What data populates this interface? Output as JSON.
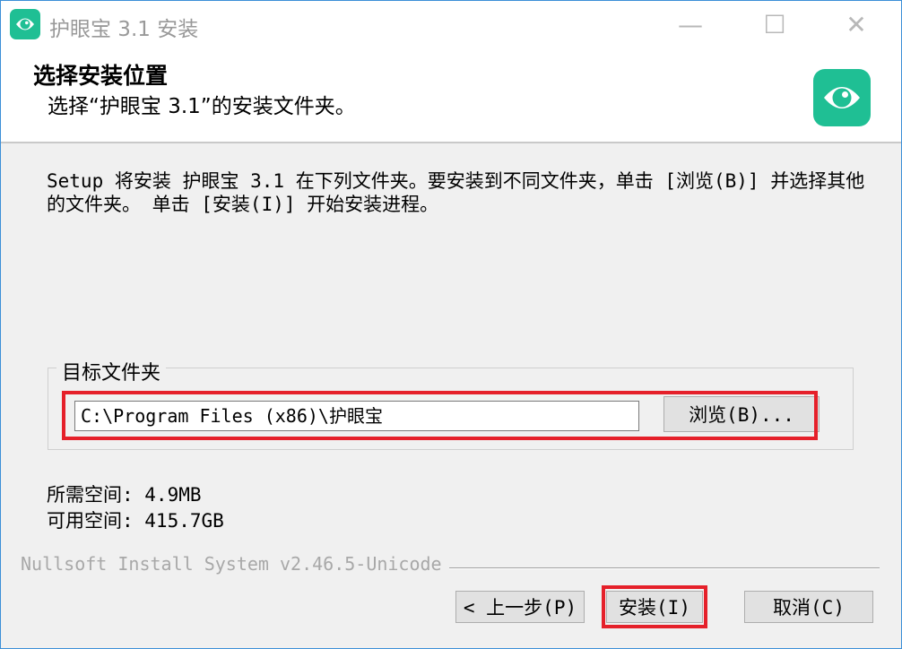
{
  "window": {
    "title": "护眼宝 3.1 安装",
    "minimize_glyph": "—",
    "maximize_glyph": "☐",
    "close_glyph": "✕"
  },
  "header": {
    "title": "选择安装位置",
    "subtitle": "选择“护眼宝 3.1”的安装文件夹。",
    "logo_icon": "eye-icon"
  },
  "body": {
    "intro_text": "Setup 将安装 护眼宝 3.1 在下列文件夹。要安装到不同文件夹，单击 [浏览(B)] 并选择其他的文件夹。 单击 [安装(I)] 开始安装进程。"
  },
  "destination": {
    "group_label": "目标文件夹",
    "path_value": "C:\\Program Files (x86)\\护眼宝",
    "browse_label": "浏览(B)..."
  },
  "space": {
    "required": "所需空间: 4.9MB",
    "available": "可用空间: 415.7GB"
  },
  "footer": {
    "brand": "Nullsoft Install System v2.46.5-Unicode",
    "back_label": "< 上一步(P)",
    "install_label": "安装(I)",
    "cancel_label": "取消(C)"
  },
  "colors": {
    "accent": "#1fbf94",
    "highlight": "#e5202a",
    "window_border": "#3c8fd8"
  }
}
